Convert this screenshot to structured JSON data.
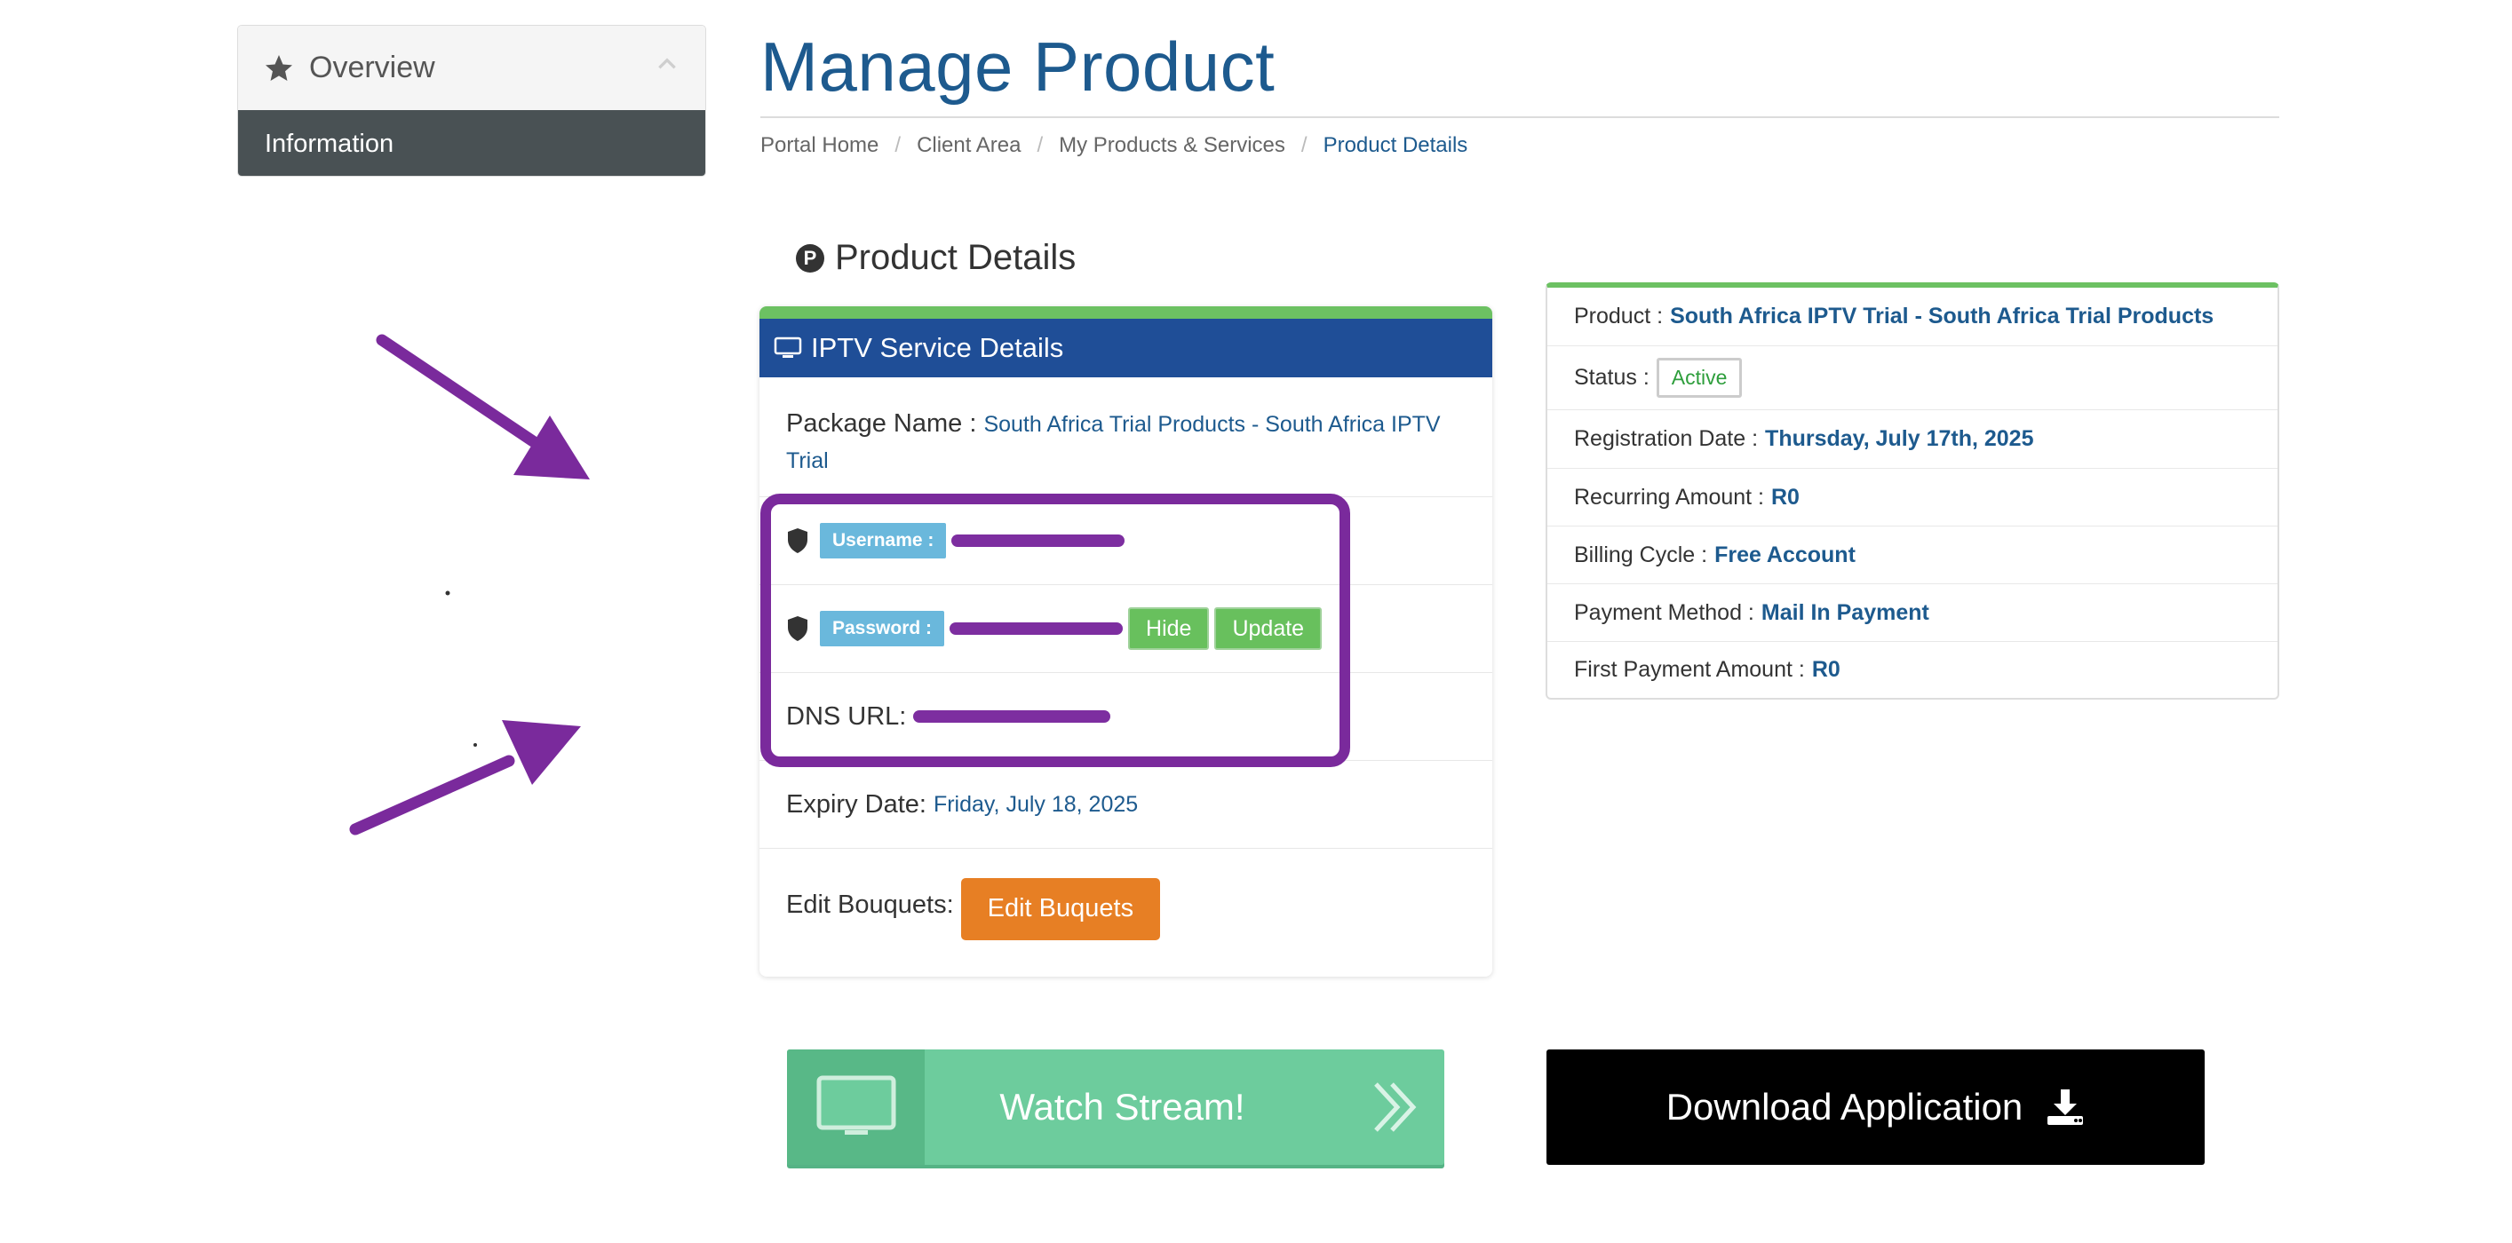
{
  "sidebar": {
    "header_title": "Overview",
    "items": [
      {
        "label": "Information"
      }
    ]
  },
  "page": {
    "title": "Manage Product",
    "breadcrumb": [
      "Portal Home",
      "Client Area",
      "My Products & Services",
      "Product Details"
    ],
    "section_title": "Product Details",
    "section_icon_letter": "P"
  },
  "service": {
    "header": "IPTV Service Details",
    "package_label": "Package Name :",
    "package_value": "South Africa Trial Products - South Africa IPTV Trial",
    "username_label": "Username :",
    "password_label": "Password :",
    "hide_label": "Hide",
    "update_label": "Update",
    "dns_label": "DNS URL:",
    "expiry_label": "Expiry Date:",
    "expiry_value": "Friday, July 18, 2025",
    "bouquets_label": "Edit Bouquets:",
    "bouquets_button": "Edit Buquets"
  },
  "info": {
    "product_label": "Product :",
    "product_value": "South Africa IPTV Trial - South Africa Trial Products",
    "status_label": "Status :",
    "status_value": "Active",
    "regdate_label": "Registration Date :",
    "regdate_value": "Thursday, July 17th, 2025",
    "recurring_label": "Recurring Amount :",
    "recurring_value": "R0",
    "billing_label": "Billing Cycle :",
    "billing_value": "Free Account",
    "payment_label": "Payment Method :",
    "payment_value": "Mail In Payment",
    "first_label": "First Payment Amount :",
    "first_value": "R0"
  },
  "actions": {
    "watch_label": "Watch Stream!",
    "download_label": "Download Application"
  },
  "colors": {
    "brand_blue": "#1d5a8e",
    "header_blue": "#1f4e97",
    "annotation_purple": "#7a2a9c",
    "status_green": "#2e9e3c"
  },
  "icons": [
    "star-icon",
    "chevron-up-icon",
    "monitor-icon",
    "shield-icon",
    "tv-icon",
    "double-chevron-right-icon",
    "download-icon"
  ]
}
